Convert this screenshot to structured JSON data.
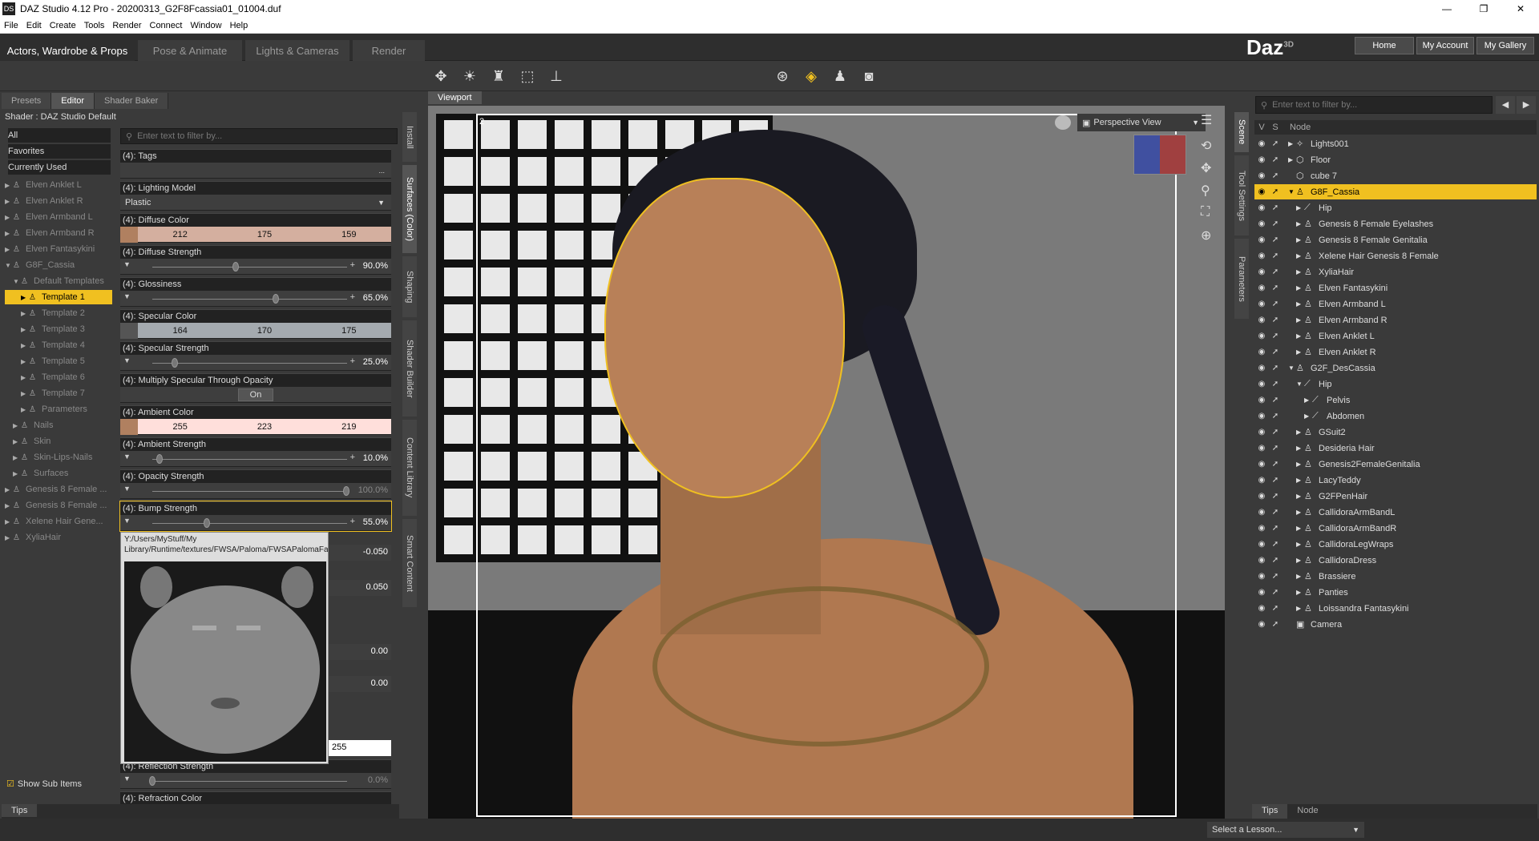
{
  "window": {
    "title": "DAZ Studio 4.12 Pro - 20200313_G2F8Fcassia01_01004.duf",
    "app_icon": "DS",
    "controls": [
      "—",
      "❐",
      "✕"
    ]
  },
  "menu": [
    "File",
    "Edit",
    "Create",
    "Tools",
    "Render",
    "Connect",
    "Window",
    "Help"
  ],
  "activity_tabs": [
    "Actors, Wardrobe & Props",
    "Pose & Animate",
    "Lights & Cameras",
    "Render"
  ],
  "brand": {
    "logo": "Daz",
    "logo_sup": "3D",
    "home": "Home",
    "account": "My Account",
    "gallery": "My Gallery"
  },
  "left_panel": {
    "tabs": [
      "Presets",
      "Editor",
      "Shader Baker"
    ],
    "shader_label": "Shader : DAZ Studio Default",
    "filter_placeholder": "Enter text to filter by...",
    "categories": [
      "All",
      "Favorites",
      "Currently Used"
    ],
    "tree": [
      {
        "label": "Elven Anklet L",
        "indent": 0,
        "arrow": "▶"
      },
      {
        "label": "Elven Anklet R",
        "indent": 0,
        "arrow": "▶"
      },
      {
        "label": "Elven Armband L",
        "indent": 0,
        "arrow": "▶"
      },
      {
        "label": "Elven Armband R",
        "indent": 0,
        "arrow": "▶"
      },
      {
        "label": "Elven Fantasykini",
        "indent": 0,
        "arrow": "▶"
      },
      {
        "label": "G8F_Cassia",
        "indent": 0,
        "arrow": "▼"
      },
      {
        "label": "Default Templates",
        "indent": 1,
        "arrow": "▼"
      },
      {
        "label": "Template 1",
        "indent": 2,
        "arrow": "▶",
        "selected": true
      },
      {
        "label": "Template 2",
        "indent": 2,
        "arrow": "▶"
      },
      {
        "label": "Template 3",
        "indent": 2,
        "arrow": "▶"
      },
      {
        "label": "Template 4",
        "indent": 2,
        "arrow": "▶"
      },
      {
        "label": "Template 5",
        "indent": 2,
        "arrow": "▶"
      },
      {
        "label": "Template 6",
        "indent": 2,
        "arrow": "▶"
      },
      {
        "label": "Template 7",
        "indent": 2,
        "arrow": "▶"
      },
      {
        "label": "Parameters",
        "indent": 2,
        "arrow": "▶"
      },
      {
        "label": "Nails",
        "indent": 1,
        "arrow": "▶"
      },
      {
        "label": "Skin",
        "indent": 1,
        "arrow": "▶"
      },
      {
        "label": "Skin-Lips-Nails",
        "indent": 1,
        "arrow": "▶"
      },
      {
        "label": "Surfaces",
        "indent": 1,
        "arrow": "▶"
      },
      {
        "label": "Genesis 8 Female ...",
        "indent": 0,
        "arrow": "▶"
      },
      {
        "label": "Genesis 8 Female ...",
        "indent": 0,
        "arrow": "▶"
      },
      {
        "label": "Xelene Hair Gene...",
        "indent": 0,
        "arrow": "▶"
      },
      {
        "label": "XyliaHair",
        "indent": 0,
        "arrow": "▶"
      }
    ],
    "show_sub_items": "Show Sub Items",
    "tips": "Tips",
    "props": {
      "tags": "(4): Tags",
      "tags_btn": "...",
      "lighting_model": "(4): Lighting Model",
      "lighting_value": "Plastic",
      "diffuse_color": "(4): Diffuse Color",
      "diffuse_r": "212",
      "diffuse_g": "175",
      "diffuse_b": "159",
      "diffuse_hex": "#d4af9f",
      "diffuse_strength": "(4): Diffuse Strength",
      "diffuse_strength_val": "90.0%",
      "glossiness": "(4): Glossiness",
      "glossiness_val": "65.0%",
      "specular_color": "(4): Specular Color",
      "specular_r": "164",
      "specular_g": "170",
      "specular_b": "175",
      "specular_hex": "#a4aaaf",
      "specular_strength": "(4): Specular Strength",
      "specular_strength_val": "25.0%",
      "multiply_specular": "(4): Multiply Specular Through Opacity",
      "multiply_specular_val": "On",
      "ambient_color": "(4): Ambient Color",
      "ambient_r": "255",
      "ambient_g": "223",
      "ambient_b": "219",
      "ambient_hex": "#ffdfdb",
      "ambient_strength": "(4): Ambient Strength",
      "ambient_strength_val": "10.0%",
      "opacity_strength": "(4): Opacity Strength",
      "opacity_strength_val": "100.0%",
      "bump_strength": "(4): Bump Strength",
      "bump_strength_val": "55.0%",
      "tooltip_path": "Y:/Users/MyStuff/My Library/Runtime/textures/FWSA/Paloma/FWSAPalomaFaceB_1001.jpg",
      "v1": "-0.050",
      "v2": "0.050",
      "v3": "0.00",
      "v4": "0.00",
      "v5": "255",
      "reflection_strength": "(4): Reflection Strength",
      "reflection_strength_val": "0.0%",
      "refraction_color": "(4): Refraction Color"
    }
  },
  "side_tabs_left": [
    "Install",
    "Surfaces (Color)",
    "Shaping",
    "Shader Builder",
    "Content Library",
    "Smart Content"
  ],
  "viewport": {
    "tab": "Viewport",
    "view": "Perspective View",
    "corner": "2"
  },
  "side_tabs_right": [
    "Scene",
    "Tool Settings",
    "Parameters"
  ],
  "scene": {
    "filter_placeholder": "Enter text to filter by...",
    "col_v": "V",
    "col_s": "S",
    "col_node": "Node",
    "rows": [
      {
        "name": "Lights001",
        "indent": 0,
        "arrow": "▶",
        "icon": "✧"
      },
      {
        "name": "Floor",
        "indent": 0,
        "arrow": "▶",
        "icon": "⬡"
      },
      {
        "name": "cube 7",
        "indent": 0,
        "arrow": "",
        "icon": "⬡"
      },
      {
        "name": "G8F_Cassia",
        "indent": 0,
        "arrow": "▼",
        "icon": "♙",
        "selected": true
      },
      {
        "name": "Hip",
        "indent": 1,
        "arrow": "▶",
        "icon": "⟋"
      },
      {
        "name": "Genesis 8 Female Eyelashes",
        "indent": 1,
        "arrow": "▶",
        "icon": "♙"
      },
      {
        "name": "Genesis 8 Female Genitalia",
        "indent": 1,
        "arrow": "▶",
        "icon": "♙"
      },
      {
        "name": "Xelene Hair Genesis 8 Female",
        "indent": 1,
        "arrow": "▶",
        "icon": "♙"
      },
      {
        "name": "XyliaHair",
        "indent": 1,
        "arrow": "▶",
        "icon": "♙"
      },
      {
        "name": "Elven Fantasykini",
        "indent": 1,
        "arrow": "▶",
        "icon": "♙"
      },
      {
        "name": "Elven Armband L",
        "indent": 1,
        "arrow": "▶",
        "icon": "♙"
      },
      {
        "name": "Elven Armband R",
        "indent": 1,
        "arrow": "▶",
        "icon": "♙"
      },
      {
        "name": "Elven Anklet L",
        "indent": 1,
        "arrow": "▶",
        "icon": "♙"
      },
      {
        "name": "Elven Anklet R",
        "indent": 1,
        "arrow": "▶",
        "icon": "♙"
      },
      {
        "name": "G2F_DesCassia",
        "indent": 0,
        "arrow": "▼",
        "icon": "♙"
      },
      {
        "name": "Hip",
        "indent": 1,
        "arrow": "▼",
        "icon": "⟋"
      },
      {
        "name": "Pelvis",
        "indent": 2,
        "arrow": "▶",
        "icon": "⟋"
      },
      {
        "name": "Abdomen",
        "indent": 2,
        "arrow": "▶",
        "icon": "⟋"
      },
      {
        "name": "GSuit2",
        "indent": 1,
        "arrow": "▶",
        "icon": "♙"
      },
      {
        "name": "Desideria Hair",
        "indent": 1,
        "arrow": "▶",
        "icon": "♙"
      },
      {
        "name": "Genesis2FemaleGenitalia",
        "indent": 1,
        "arrow": "▶",
        "icon": "♙"
      },
      {
        "name": "LacyTeddy",
        "indent": 1,
        "arrow": "▶",
        "icon": "♙"
      },
      {
        "name": "G2FPenHair",
        "indent": 1,
        "arrow": "▶",
        "icon": "♙"
      },
      {
        "name": "CallidoraArmBandL",
        "indent": 1,
        "arrow": "▶",
        "icon": "♙"
      },
      {
        "name": "CallidoraArmBandR",
        "indent": 1,
        "arrow": "▶",
        "icon": "♙"
      },
      {
        "name": "CallidoraLegWraps",
        "indent": 1,
        "arrow": "▶",
        "icon": "♙"
      },
      {
        "name": "CallidoraDress",
        "indent": 1,
        "arrow": "▶",
        "icon": "♙"
      },
      {
        "name": "Brassiere",
        "indent": 1,
        "arrow": "▶",
        "icon": "♙"
      },
      {
        "name": "Panties",
        "indent": 1,
        "arrow": "▶",
        "icon": "♙"
      },
      {
        "name": "Loissandra Fantasykini",
        "indent": 1,
        "arrow": "▶",
        "icon": "♙"
      },
      {
        "name": "Camera",
        "indent": 0,
        "arrow": "",
        "icon": "▣"
      }
    ],
    "bottom_tabs": [
      "Tips",
      "Node"
    ]
  },
  "status": {
    "lesson": "Select a Lesson..."
  },
  "colors": {
    "accent": "#f0c020",
    "panel": "#3a3a3a",
    "dark": "#222222"
  }
}
